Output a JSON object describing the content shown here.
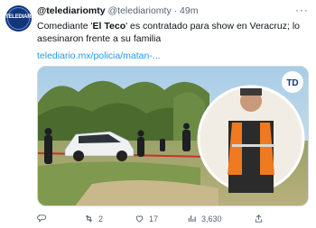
{
  "tweet": {
    "account_name": "@telediariomty",
    "handle": "@telediariomty",
    "separator": "·",
    "time": "49m",
    "text_before": "Comediante '",
    "text_bold": "El Teco",
    "text_after": "' es contratado para show en Veracruz; lo asesinaron frente a su familia",
    "link": "telediario.mx/policia/matan-...",
    "avatar_logo": "TELEDIARIO",
    "media_badge": "TD",
    "more_icon": "ellipsis-icon"
  },
  "actions": {
    "replies": "",
    "retweets": "2",
    "likes": "17",
    "views": "3,630",
    "share": ""
  },
  "colors": {
    "link": "#1d9bf0",
    "muted": "#536471",
    "avatar_bg": "#13367a"
  }
}
